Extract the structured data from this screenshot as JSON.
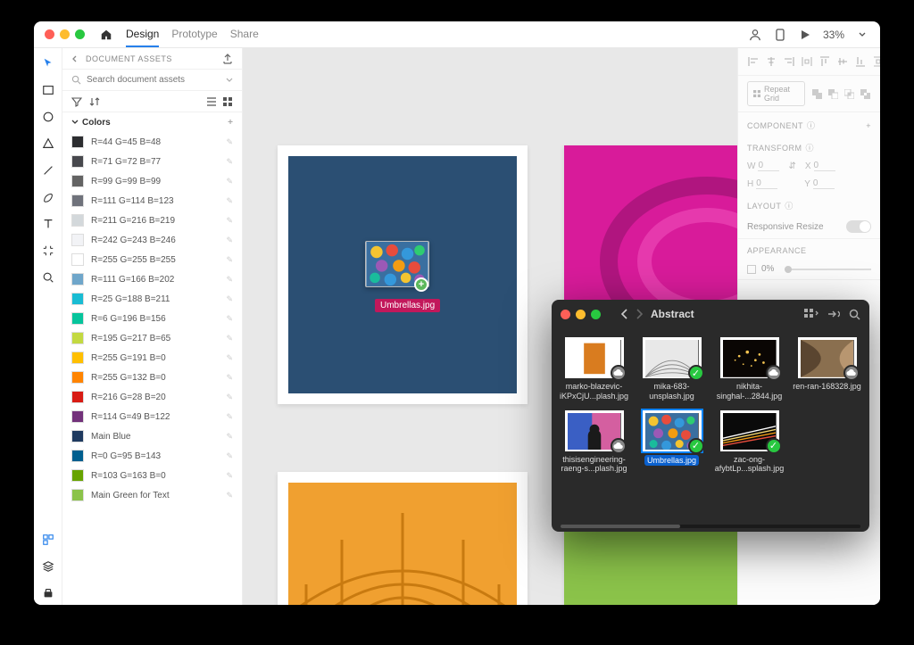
{
  "app": {
    "tabs": [
      "Design",
      "Prototype",
      "Share"
    ],
    "active_tab": 0,
    "zoom": "33%"
  },
  "assets_panel": {
    "title": "DOCUMENT ASSETS",
    "search_placeholder": "Search document assets",
    "section_colors": "Colors",
    "colors": [
      {
        "hex": "#2c2d30",
        "label": "R=44 G=45 B=48"
      },
      {
        "hex": "#47484d",
        "label": "R=71 G=72 B=77"
      },
      {
        "hex": "#636363",
        "label": "R=99 G=99 B=99"
      },
      {
        "hex": "#6f727b",
        "label": "R=111 G=114 B=123"
      },
      {
        "hex": "#d3d8db",
        "label": "R=211 G=216 B=219"
      },
      {
        "hex": "#f2f3f6",
        "label": "R=242 G=243 B=246"
      },
      {
        "hex": "#ffffff",
        "label": "R=255 G=255 B=255"
      },
      {
        "hex": "#6fa6ca",
        "label": "R=111 G=166 B=202"
      },
      {
        "hex": "#19bcd3",
        "label": "R=25 G=188 B=211"
      },
      {
        "hex": "#06c49c",
        "label": "R=6 G=196 B=156"
      },
      {
        "hex": "#c3d941",
        "label": "R=195 G=217 B=65"
      },
      {
        "hex": "#ffbf00",
        "label": "R=255 G=191 B=0"
      },
      {
        "hex": "#ff8400",
        "label": "R=255 G=132 B=0"
      },
      {
        "hex": "#d81c14",
        "label": "R=216 G=28 B=20"
      },
      {
        "hex": "#72317a",
        "label": "R=114 G=49 B=122"
      },
      {
        "hex": "#1f3a5f",
        "label": "Main Blue"
      },
      {
        "hex": "#005f8f",
        "label": "R=0 G=95 B=143"
      },
      {
        "hex": "#67a300",
        "label": "R=103 G=163 B=0"
      },
      {
        "hex": "#8bc34a",
        "label": "Main Green for Text"
      }
    ]
  },
  "drag": {
    "filename": "Umbrellas.jpg"
  },
  "right_panel": {
    "repeat_grid": "Repeat Grid",
    "component": "COMPONENT",
    "transform": "TRANSFORM",
    "w": "W",
    "w_val": "0",
    "h": "H",
    "h_val": "0",
    "x": "X",
    "x_val": "0",
    "y": "Y",
    "y_val": "0",
    "layout": "LAYOUT",
    "responsive": "Responsive Resize",
    "appearance": "APPEARANCE",
    "opacity": "0%"
  },
  "finder": {
    "title": "Abstract",
    "items": [
      {
        "label": "marko-blazevic-iKPxCjU...plash.jpg",
        "badge": "cloud",
        "bg": "#d97c1f"
      },
      {
        "label": "mika-683-unsplash.jpg",
        "badge": "check",
        "bg": "#e8e8e8"
      },
      {
        "label": "nikhita-singhal-...2844.jpg",
        "badge": "cloud",
        "bg": "#1a1208"
      },
      {
        "label": "ren-ran-168328.jpg",
        "badge": "cloud",
        "bg": "#8a6f4f"
      },
      {
        "label": "thisisengineering-raeng-s...plash.jpg",
        "badge": "cloud",
        "bg": "#3a5fc4"
      },
      {
        "label": "Umbrellas.jpg",
        "badge": "check",
        "bg": "#3a6fa0",
        "selected": true
      },
      {
        "label": "zac-ong-afybtLp...splash.jpg",
        "badge": "check",
        "bg": "#0a0a0a"
      }
    ]
  }
}
